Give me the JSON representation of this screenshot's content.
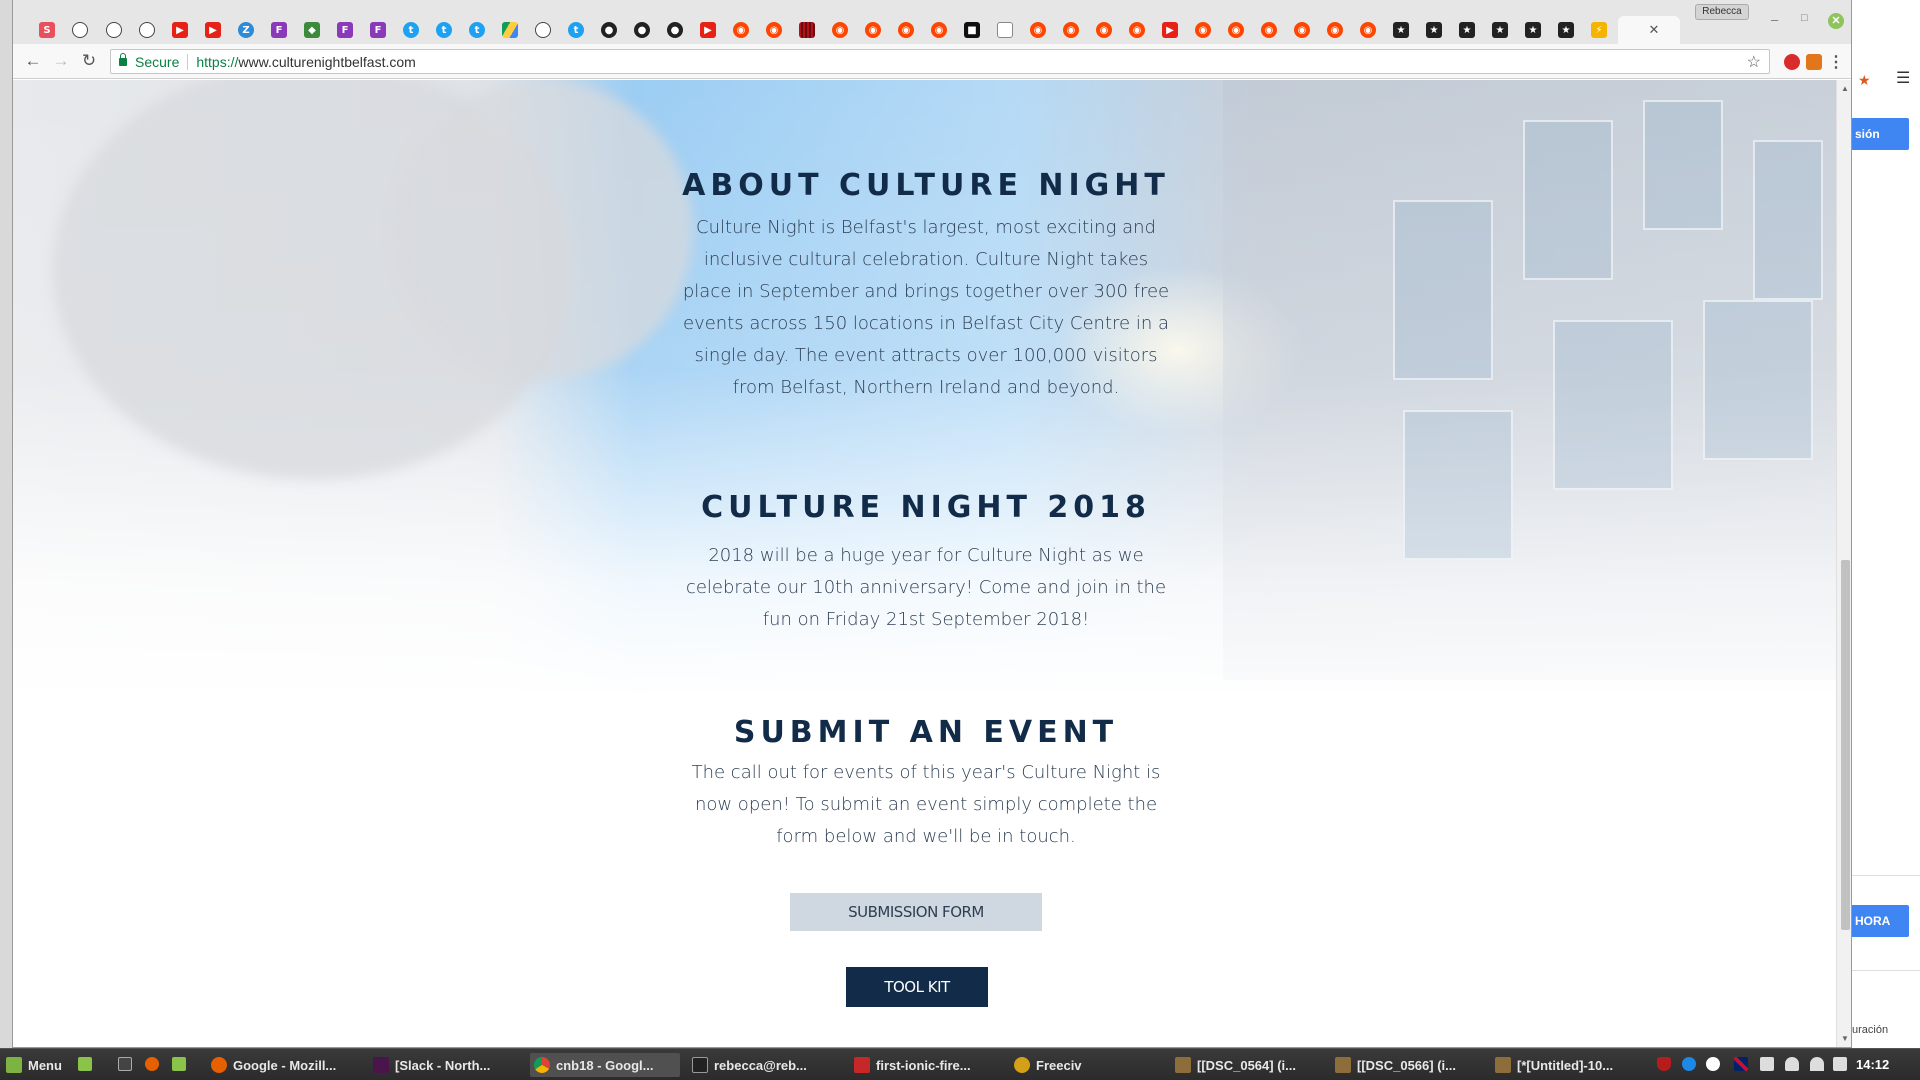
{
  "browser": {
    "profile_name": "Rebecca",
    "secure_label": "Secure",
    "url_scheme": "https://",
    "url_rest": "www.culturenightbelfast.com"
  },
  "background_window": {
    "top_button": "sión",
    "bottom_button": "HORA",
    "footer_text": "uración"
  },
  "page": {
    "about": {
      "heading": "ABOUT CULTURE NIGHT",
      "body": "Culture Night is Belfast's largest, most exciting and inclusive cultural celebration. Culture Night takes place in September and brings together over 300 free events across 150 locations in Belfast City Centre in a single day. The event attracts over 100,000 visitors from Belfast, Northern Ireland and beyond."
    },
    "year": {
      "heading": "CULTURE NIGHT 2018",
      "body": "2018 will be a huge year for Culture Night as we celebrate our 10th anniversary! Come and join in the fun on Friday 21st September 2018!"
    },
    "submit": {
      "heading": "SUBMIT AN EVENT",
      "body": "The call out for events of this year's Culture Night is now open! To submit an event simply complete the form below and we'll be in touch."
    },
    "buttons": {
      "submission_form": "SUBMISSION FORM",
      "tool_kit": "TOOL KIT"
    },
    "colors": {
      "heading": "#112b48",
      "toolkit_bg": "#112b48",
      "submission_bg": "#cfd8e0"
    }
  },
  "taskbar": {
    "menu_label": "Menu",
    "items": [
      {
        "label": "Google - Mozill...",
        "icon": "firefox-icon"
      },
      {
        "label": "[Slack - North...",
        "icon": "slack-icon"
      },
      {
        "label": "cnb18 - Googl...",
        "icon": "chrome-icon"
      },
      {
        "label": "rebecca@reb...",
        "icon": "terminal-icon"
      },
      {
        "label": "first-ionic-fire...",
        "icon": "editor-icon"
      },
      {
        "label": "Freeciv",
        "icon": "freeciv-icon"
      },
      {
        "label": "[[DSC_0564] (i...",
        "icon": "gimp-icon"
      },
      {
        "label": "[[DSC_0566] (i...",
        "icon": "gimp-icon"
      },
      {
        "label": "[*[Untitled]-10...",
        "icon": "gimp-icon"
      }
    ],
    "clock": "14:12"
  }
}
